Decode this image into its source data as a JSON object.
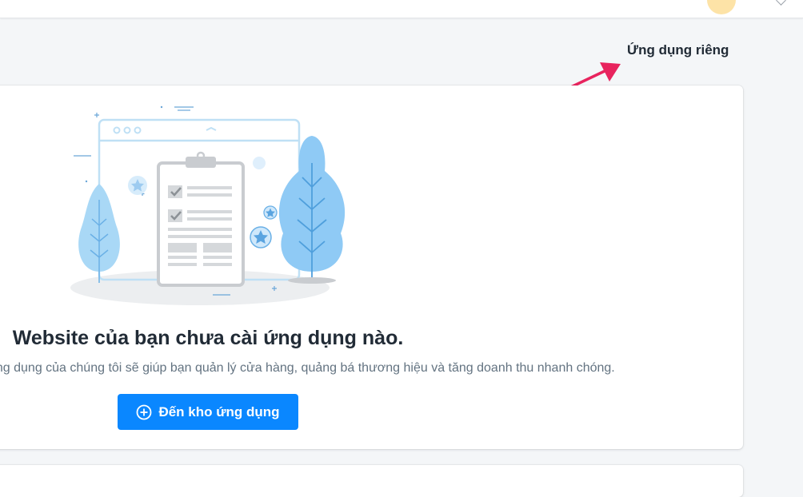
{
  "header": {
    "private_apps_link": "Ứng dụng riêng"
  },
  "empty_state": {
    "title": "Website của bạn chưa cài ứng dụng nào.",
    "description": "Các ứng dụng của chúng tôi sẽ giúp bạn quản lý cửa hàng, quảng bá thương hiệu và tăng doanh thu nhanh chóng.",
    "button_label": "Đến kho ứng dụng",
    "button_icon": "plus-circle-icon",
    "illustration": "clipboard-checklist-illustration"
  },
  "colors": {
    "primary": "#0a87ff",
    "annotation_arrow": "#e8245e",
    "title_text": "#212b36",
    "muted_text": "#637381"
  }
}
